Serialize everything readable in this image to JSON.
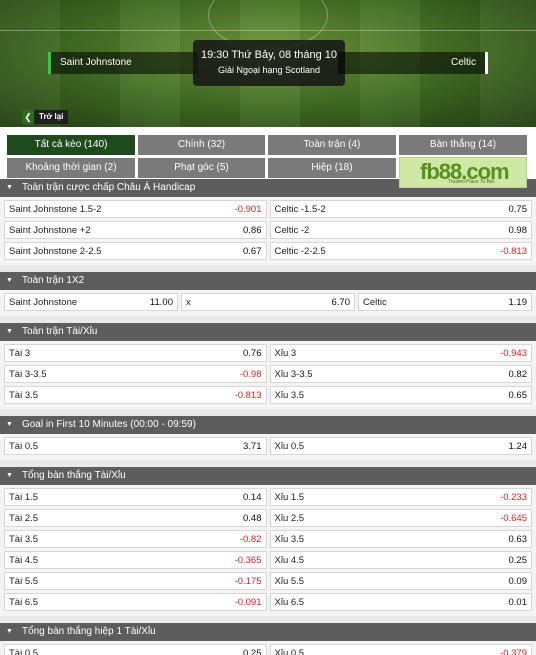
{
  "match": {
    "home": "Saint Johnstone",
    "away": "Celtic",
    "time": "19:30 Thứ Bảy, 08 tháng 10",
    "league": "Giải Ngoại hạng Scotland",
    "back": "Trở lại"
  },
  "filters": [
    {
      "label": "Tất cả kèo (140)",
      "active": true
    },
    {
      "label": "Chính (32)"
    },
    {
      "label": "Toàn trận (4)"
    },
    {
      "label": "Bàn thắng (14)"
    },
    {
      "label": "Khoảng thời gian (2)"
    },
    {
      "label": "Phạt góc (5)"
    },
    {
      "label": "Hiệp (18)"
    }
  ],
  "logo": {
    "text": "fb88.com",
    "sub": "Trusted Place To Bet"
  },
  "sections": {
    "s0": {
      "title": "Toàn trận cược chấp Châu Á Handicap",
      "rows": [
        [
          {
            "l": "Saint Johnstone 1.5-2",
            "o": "-0.901"
          },
          {
            "l": "Celtic -1.5-2",
            "o": "0.75"
          }
        ],
        [
          {
            "l": "Saint Johnstone +2",
            "o": "0.86"
          },
          {
            "l": "Celtic -2",
            "o": "0.98"
          }
        ],
        [
          {
            "l": "Saint Johnstone 2-2.5",
            "o": "0.67"
          },
          {
            "l": "Celtic -2-2.5",
            "o": "-0.813"
          }
        ]
      ]
    },
    "s1": {
      "title": "Toàn trận 1X2",
      "rows": [
        [
          {
            "l": "Saint Johnstone",
            "o": "11.00"
          },
          {
            "l": "x",
            "o": "6.70"
          },
          {
            "l": "Celtic",
            "o": "1.19"
          }
        ]
      ]
    },
    "s2": {
      "title": "Toàn trận Tài/Xỉu",
      "rows": [
        [
          {
            "l": "Tài 3",
            "o": "0.76"
          },
          {
            "l": "Xỉu 3",
            "o": "-0.943"
          }
        ],
        [
          {
            "l": "Tài 3-3.5",
            "o": "-0.98"
          },
          {
            "l": "Xỉu 3-3.5",
            "o": "0.82"
          }
        ],
        [
          {
            "l": "Tài 3.5",
            "o": "-0.813"
          },
          {
            "l": "Xỉu 3.5",
            "o": "0.65"
          }
        ]
      ]
    },
    "s3": {
      "title": "Goal in First 10 Minutes (00:00 - 09:59)",
      "rows": [
        [
          {
            "l": "Tài 0.5",
            "o": "3.71"
          },
          {
            "l": "Xỉu 0.5",
            "o": "1.24"
          }
        ]
      ]
    },
    "s4": {
      "title": "Tổng bàn thắng Tài/Xỉu",
      "rows": [
        [
          {
            "l": "Tài 1.5",
            "o": "0.14"
          },
          {
            "l": "Xỉu 1.5",
            "o": "-0.233"
          }
        ],
        [
          {
            "l": "Tài 2.5",
            "o": "0.48"
          },
          {
            "l": "Xỉu 2.5",
            "o": "-0.645"
          }
        ],
        [
          {
            "l": "Tài 3.5",
            "o": "-0.82"
          },
          {
            "l": "Xỉu 3.5",
            "o": "0.63"
          }
        ],
        [
          {
            "l": "Tài 4.5",
            "o": "-0.365"
          },
          {
            "l": "Xỉu 4.5",
            "o": "0.25"
          }
        ],
        [
          {
            "l": "Tài 5.5",
            "o": "-0.175"
          },
          {
            "l": "Xỉu 5.5",
            "o": "0.09"
          }
        ],
        [
          {
            "l": "Tài 6.5",
            "o": "-0.091"
          },
          {
            "l": "Xỉu 6.5",
            "o": "0.01"
          }
        ]
      ]
    },
    "s5": {
      "title": "Tổng bàn thắng hiệp 1 Tài/Xỉu",
      "rows": [
        [
          {
            "l": "Tài 0.5",
            "o": "0.25"
          },
          {
            "l": "Xỉu 0.5",
            "o": "-0.379"
          }
        ]
      ]
    }
  }
}
